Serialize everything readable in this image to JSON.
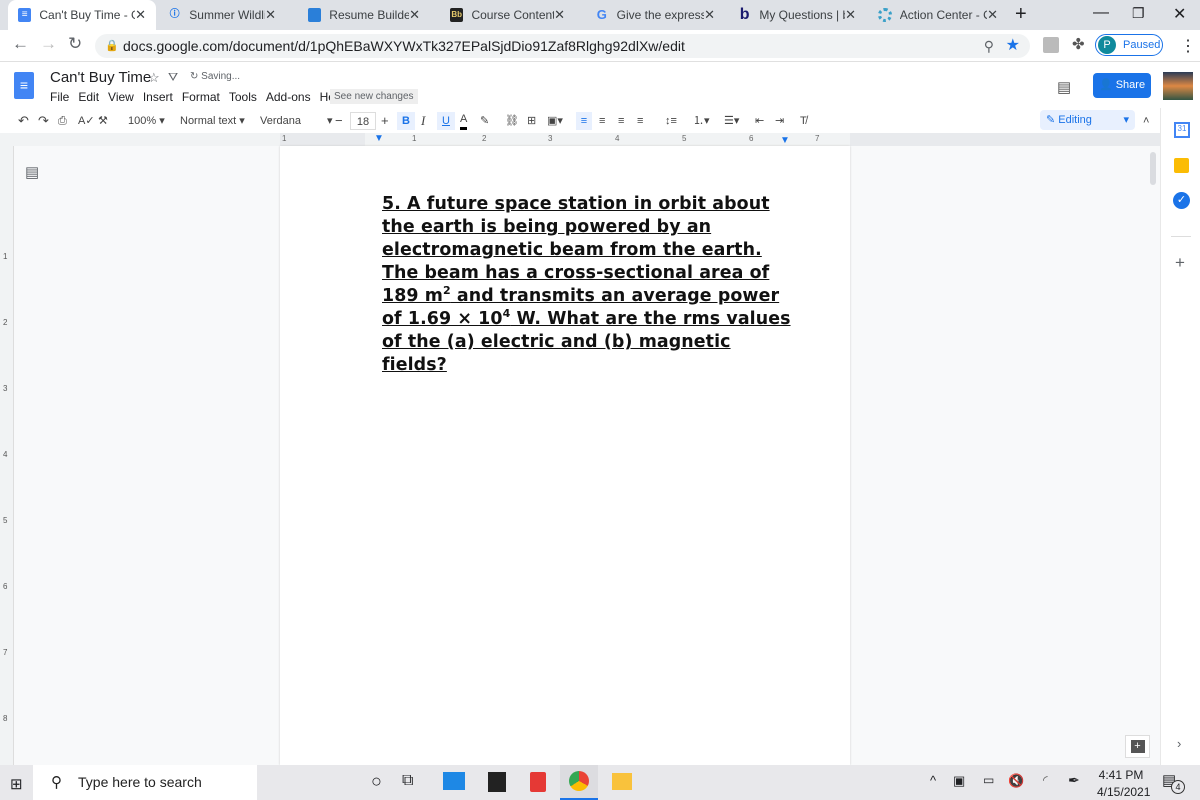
{
  "browser": {
    "tabs": [
      {
        "title": "Can't Buy Time - G",
        "icon": "google-docs-icon",
        "active": true
      },
      {
        "title": "Summer Wildlife In",
        "icon": "info-icon"
      },
      {
        "title": "Resume Builder · R",
        "icon": "resume-icon"
      },
      {
        "title": "Course Content – ",
        "icon": "bb-icon"
      },
      {
        "title": "Give the expressio",
        "icon": "google-icon"
      },
      {
        "title": "My Questions | ba",
        "icon": "bartleby-icon"
      },
      {
        "title": "Action Center - Oc",
        "icon": "action-center-icon"
      }
    ],
    "url": "docs.google.com/document/d/1pQhEBaWXYWxTk327EPalSjdDio91Zaf8Rlghg92dlXw/edit",
    "profile_initial": "P",
    "profile_status": "Paused"
  },
  "docs": {
    "title": "Can't Buy Time",
    "status": "Saving...",
    "menu": [
      "File",
      "Edit",
      "View",
      "Insert",
      "Format",
      "Tools",
      "Add-ons",
      "Help"
    ],
    "see_changes": "See new changes",
    "share": "Share",
    "toolbar": {
      "zoom": "100%",
      "style": "Normal text",
      "font": "Verdana",
      "size": "18",
      "mode": "Editing",
      "bold": "B",
      "italic": "I",
      "underline": "U",
      "textcolor": "A"
    },
    "ruler": [
      "1",
      "1",
      "2",
      "3",
      "4",
      "5",
      "6",
      "7"
    ],
    "vruler": [
      "1",
      "2",
      "3",
      "4",
      "5",
      "6",
      "7",
      "8"
    ],
    "content": {
      "part1": "5. A future space station in orbit about the earth is being powered by an electromagnetic beam from the earth. The beam has a cross-sectional area of 189 m",
      "sup1": "2",
      "part2": " and transmits an average power of 1.69 × 10",
      "sup2": "4",
      "part3": " W. What are the rms values of the (a) electric and (b) magnetic fields?"
    }
  },
  "taskbar": {
    "search_placeholder": "Type here to search",
    "time": "4:41 PM",
    "date": "4/15/2021",
    "notifications": "4"
  },
  "colors": {
    "accent": "#1a73e8",
    "tabbar": "#dee1e6"
  }
}
